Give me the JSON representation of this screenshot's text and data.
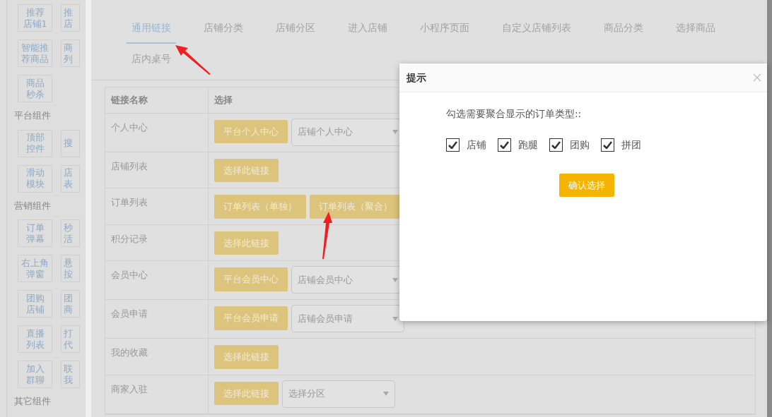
{
  "sidebar": {
    "sections": [
      {
        "rows": [
          [
            {
              "lines": [
                "推荐",
                "店铺1"
              ]
            },
            {
              "lines": [
                "推",
                "店"
              ]
            }
          ],
          [
            {
              "lines": [
                "智能推",
                "荐商品"
              ]
            },
            {
              "lines": [
                "商",
                "列"
              ]
            }
          ],
          [
            {
              "lines": [
                "商品",
                "秒杀"
              ]
            }
          ]
        ]
      },
      {
        "title": "平台组件",
        "rows": [
          [
            {
              "lines": [
                "顶部",
                "控件"
              ]
            },
            {
              "lines": [
                "搜"
              ]
            }
          ],
          [
            {
              "lines": [
                "滑动",
                "模块"
              ]
            },
            {
              "lines": [
                "店",
                "表"
              ]
            }
          ]
        ]
      },
      {
        "title": "营销组件",
        "rows": [
          [
            {
              "lines": [
                "订单",
                "弹幕"
              ]
            },
            {
              "lines": [
                "秒",
                "活"
              ]
            }
          ],
          [
            {
              "lines": [
                "右上角",
                "弹窗"
              ]
            },
            {
              "lines": [
                "悬",
                "按"
              ]
            }
          ],
          [
            {
              "lines": [
                "团购",
                "店铺"
              ]
            },
            {
              "lines": [
                "团",
                "商"
              ]
            }
          ],
          [
            {
              "lines": [
                "直播",
                "列表"
              ]
            },
            {
              "lines": [
                "打",
                "代"
              ]
            }
          ],
          [
            {
              "lines": [
                "加入",
                "群聊"
              ]
            },
            {
              "lines": [
                "联",
                "我"
              ]
            }
          ]
        ]
      },
      {
        "title": "其它组件"
      }
    ]
  },
  "tabs": [
    {
      "label": "通用链接",
      "selected": true
    },
    {
      "label": "店铺分类",
      "selected": false
    },
    {
      "label": "店铺分区",
      "selected": false
    },
    {
      "label": "进入店铺",
      "selected": false
    },
    {
      "label": "小程序页面",
      "selected": false
    },
    {
      "label": "自定义店铺列表",
      "selected": false
    },
    {
      "label": "商品分类",
      "selected": false
    },
    {
      "label": "选择商品",
      "selected": false
    },
    {
      "label": "店内桌号",
      "selected": false
    }
  ],
  "table": {
    "columns": [
      "链接名称",
      "选择"
    ],
    "rows": [
      {
        "name": "个人中心",
        "controls": [
          {
            "kind": "button",
            "label": "平台个人中心"
          },
          {
            "kind": "select",
            "value": "店铺个人中心"
          }
        ]
      },
      {
        "name": "店铺列表",
        "controls": [
          {
            "kind": "button",
            "label": "选择此链接"
          }
        ]
      },
      {
        "name": "订单列表",
        "controls": [
          {
            "kind": "button",
            "label": "订单列表（单独）"
          },
          {
            "kind": "button",
            "label": "订单列表（聚合）"
          }
        ]
      },
      {
        "name": "积分记录",
        "controls": [
          {
            "kind": "button",
            "label": "选择此链接"
          }
        ]
      },
      {
        "name": "会员中心",
        "controls": [
          {
            "kind": "button",
            "label": "平台会员中心"
          },
          {
            "kind": "select",
            "value": "店铺会员中心"
          }
        ]
      },
      {
        "name": "会员申请",
        "controls": [
          {
            "kind": "button",
            "label": "平台会员申请"
          },
          {
            "kind": "select",
            "value": "店铺会员申请"
          }
        ]
      },
      {
        "name": "我的收藏",
        "controls": [
          {
            "kind": "button",
            "label": "选择此链接"
          }
        ]
      },
      {
        "name": "商家入驻",
        "controls": [
          {
            "kind": "button",
            "label": "选择此链接"
          },
          {
            "kind": "select",
            "value": "选择分区"
          }
        ]
      }
    ]
  },
  "modal": {
    "title": "提示",
    "prompt": "勾选需要聚合显示的订单类型::",
    "options": [
      {
        "label": "店铺",
        "checked": true
      },
      {
        "label": "跑腿",
        "checked": true
      },
      {
        "label": "团购",
        "checked": true
      },
      {
        "label": "拼团",
        "checked": true
      }
    ],
    "confirm": "确认选择"
  }
}
